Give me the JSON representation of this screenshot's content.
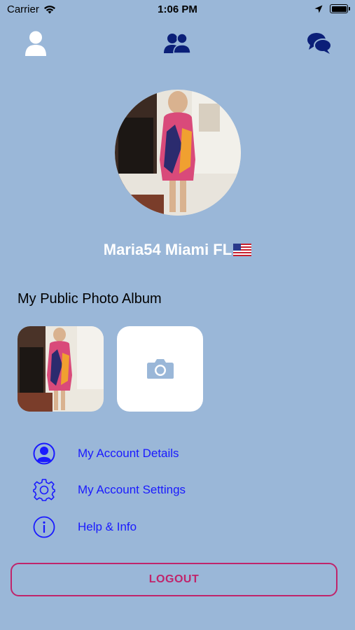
{
  "status_bar": {
    "carrier": "Carrier",
    "time": "1:06 PM",
    "wifi_icon": "wifi-icon",
    "location_icon": "location-arrow-icon",
    "battery_icon": "battery-full-icon"
  },
  "top_nav": {
    "items": [
      {
        "icon": "person-icon",
        "color": "#ffffff"
      },
      {
        "icon": "people-icon",
        "color": "#0b1f78"
      },
      {
        "icon": "chat-bubbles-icon",
        "color": "#0b1f78"
      }
    ]
  },
  "profile": {
    "name": "Maria54 Miami FL",
    "flag_icon": "us-flag-icon"
  },
  "album": {
    "title": "My Public Photo Album",
    "add_photo_icon": "camera-icon"
  },
  "menu": {
    "items": [
      {
        "label": "My Account Details",
        "icon": "user-circle-icon"
      },
      {
        "label": "My Account Settings",
        "icon": "gear-icon"
      },
      {
        "label": "Help & Info",
        "icon": "info-icon"
      }
    ]
  },
  "logout": {
    "label": "LOGOUT"
  },
  "colors": {
    "background": "#9ab7d8",
    "accent_blue": "#1a1aff",
    "nav_dark_blue": "#0b1f78",
    "logout_pink": "#c0246b"
  }
}
